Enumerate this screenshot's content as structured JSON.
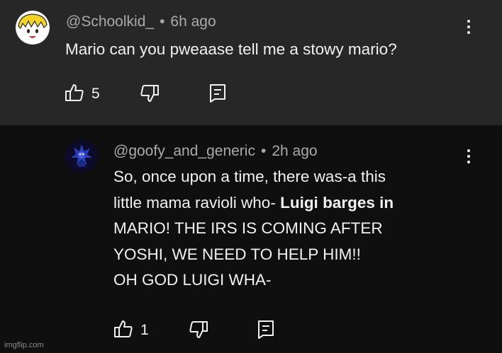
{
  "comment": {
    "username": "@Schoolkid_",
    "separator": "•",
    "time": "6h ago",
    "text": "Mario can you pweaase tell me a stowy mario?",
    "likes": "5"
  },
  "reply": {
    "username": "@goofy_and_generic",
    "separator": "•",
    "time": "2h ago",
    "lines": [
      {
        "text": "So, once upon a time, there was-a this",
        "bold": ""
      },
      {
        "text": "little mama ravioli who- ",
        "bold": "Luigi barges in"
      },
      {
        "text": "MARIO! THE IRS IS COMING AFTER",
        "bold": ""
      },
      {
        "text": "YOSHI, WE NEED TO HELP HIM!!",
        "bold": ""
      },
      {
        "text": "OH GOD LUIGI WHA-",
        "bold": ""
      }
    ],
    "likes": "1"
  },
  "watermark": "imgflip.com",
  "icons": {
    "like": "thumbs-up-icon",
    "dislike": "thumbs-down-icon",
    "reply": "reply-icon",
    "menu": "more-vertical-icon"
  },
  "colors": {
    "top_bg": "#272727",
    "reply_bg": "#0f0f0f",
    "text": "#f1f1f1",
    "meta": "#aaaaaa"
  }
}
